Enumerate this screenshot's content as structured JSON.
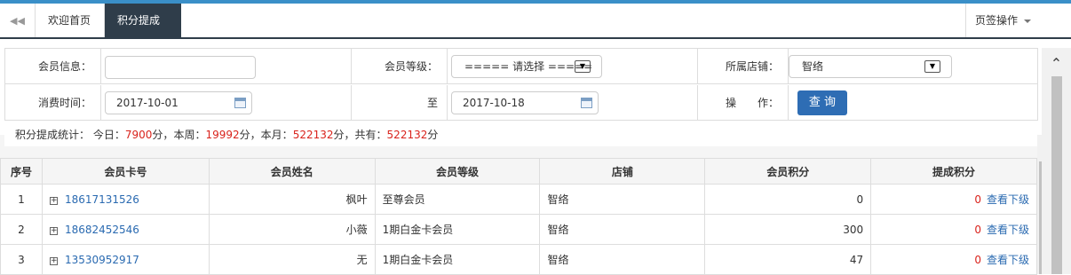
{
  "tabs": {
    "home": "欢迎首页",
    "active": "积分提成",
    "close": "✖",
    "ops": "页签操作"
  },
  "form": {
    "member_info_label": "会员信息：",
    "member_info_value": "",
    "member_level_label": "会员等级：",
    "member_level_value": "===== 请选择 =====",
    "store_label": "所属店铺：",
    "store_value": "智络",
    "consume_time_label": "消费时间：",
    "date_from": "2017-10-01",
    "to_label": "至",
    "date_to": "2017-10-18",
    "operation_label": "操　　作：",
    "query_button": "查 询"
  },
  "stats": {
    "label": "积分提成统计：",
    "today_label": "今日：",
    "today_value": "7900",
    "week_label": "本周：",
    "week_value": "19992",
    "month_label": "本月：",
    "month_value": "522132",
    "total_label": "共有：",
    "total_value": "522132",
    "unit": "分"
  },
  "table": {
    "headers": [
      "序号",
      "会员卡号",
      "会员姓名",
      "会员等级",
      "店铺",
      "会员积分",
      "提成积分"
    ],
    "rows": [
      {
        "no": "1",
        "card": "18617131526",
        "name": "枫叶",
        "level": "至尊会员",
        "store": "智络",
        "points": "0",
        "commission": "0",
        "action": "查看下级"
      },
      {
        "no": "2",
        "card": "18682452546",
        "name": "小薇",
        "level": "1期白金卡会员",
        "store": "智络",
        "points": "300",
        "commission": "0",
        "action": "查看下级"
      },
      {
        "no": "3",
        "card": "13530952917",
        "name": "无",
        "level": "1期白金卡会员",
        "store": "智络",
        "points": "47",
        "commission": "0",
        "action": "查看下级"
      }
    ]
  },
  "colors": {
    "accent": "#3a8fc8",
    "tab_active": "#2f3d4a",
    "button": "#2e6db4",
    "highlight_red": "#d9231c",
    "link": "#2a6ab1"
  }
}
